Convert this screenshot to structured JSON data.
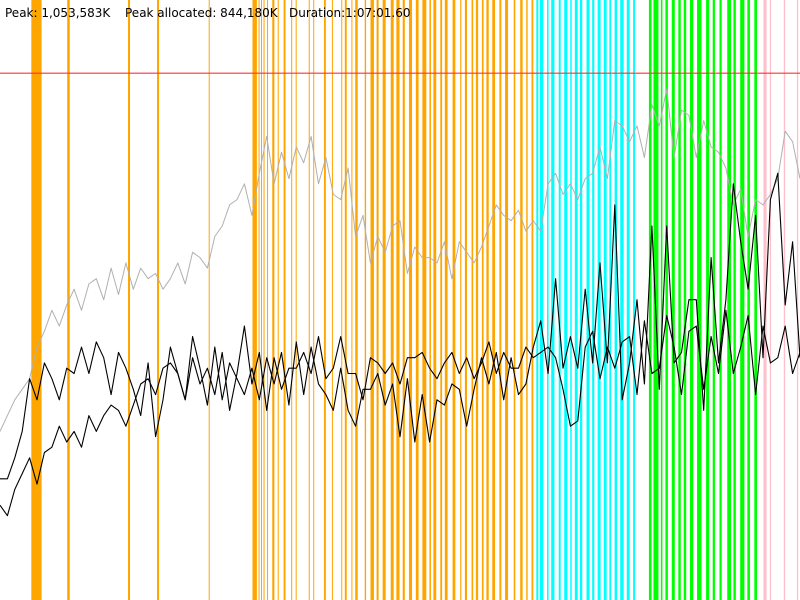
{
  "header": {
    "peak_label": "Peak: 1,053,583K",
    "peak_allocated_label": "Peak allocated: 844,180K",
    "duration_label": "Duration:1:07:01.60"
  },
  "colors": {
    "background": "#ffffff",
    "peak_line": "#ff3333",
    "series_upper": "#000000",
    "series_lower": "#000000",
    "series_gray": "#b0b0b0",
    "phase_orange": "#ffa500",
    "phase_cyan": "#00ffff",
    "phase_green": "#00ff00",
    "phase_pink": "#ffc0cb"
  },
  "chart_data": {
    "type": "line",
    "duration_s": 4021.6,
    "peak_k": 1053583,
    "peak_allocated_k": 844180,
    "y_max_k": 1200000,
    "phases": [
      {
        "color": "orange",
        "ranges": [
          [
            157.6,
            209.1
          ],
          [
            337.8,
            350.7
          ],
          [
            643.5,
            653.6
          ],
          [
            789.4,
            799.5
          ],
          [
            1049.2,
            1054.2
          ],
          [
            1269.3,
            1291.3
          ],
          [
            1299.8,
            1303.2
          ],
          [
            1312.2,
            1316.5
          ],
          [
            1324.8,
            1329.8
          ],
          [
            1342.4,
            1346.8
          ],
          [
            1368.6,
            1379.3
          ],
          [
            1396.0,
            1401.3
          ],
          [
            1425.6,
            1435.5
          ],
          [
            1463.8,
            1467.5
          ],
          [
            1486.3,
            1490.8
          ],
          [
            1552.0,
            1556.3
          ],
          [
            1574.5,
            1578.2
          ],
          [
            1628.5,
            1638.0
          ],
          [
            1668.5,
            1673.3
          ],
          [
            1715.5,
            1719.2
          ],
          [
            1733.3,
            1743.0
          ],
          [
            1766.5,
            1770.5
          ],
          [
            1785.8,
            1798.2
          ],
          [
            1833.5,
            1840.3
          ],
          [
            1862.5,
            1879.8
          ],
          [
            1893.0,
            1903.3
          ],
          [
            1923.5,
            1938.8
          ],
          [
            1964.3,
            1979.0
          ],
          [
            1992.5,
            2008.5
          ],
          [
            2024.3,
            2035.0
          ],
          [
            2055.8,
            2071.3
          ],
          [
            2090.5,
            2104.2
          ],
          [
            2123.3,
            2143.0
          ],
          [
            2158.8,
            2166.5
          ],
          [
            2178.6,
            2193.1
          ],
          [
            2213.4,
            2222.5
          ],
          [
            2236.0,
            2250.0
          ],
          [
            2275.0,
            2289.0
          ],
          [
            2313.4,
            2319.4
          ],
          [
            2337.0,
            2347.5
          ],
          [
            2370.5,
            2378.7
          ],
          [
            2392.3,
            2403.6
          ],
          [
            2422.5,
            2431.0
          ],
          [
            2445.1,
            2456.8
          ],
          [
            2474.6,
            2488.5
          ],
          [
            2510.5,
            2520.5
          ],
          [
            2538.9,
            2554.0
          ],
          [
            2582.4,
            2590.5
          ],
          [
            2615.0,
            2627.3
          ],
          [
            2645.3,
            2652.5
          ],
          [
            2672.0,
            2681.0
          ]
        ]
      },
      {
        "color": "cyan",
        "ranges": [
          [
            2696.1,
            2706.1
          ],
          [
            2713.9,
            2731.0
          ],
          [
            2749.9,
            2757.7
          ],
          [
            2771.0,
            2787.0
          ],
          [
            2808.6,
            2818.6
          ],
          [
            2836.3,
            2852.0
          ],
          [
            2866.5,
            2874.0
          ],
          [
            2889.5,
            2904.0
          ],
          [
            2915.0,
            2927.0
          ],
          [
            2948.4,
            2963.4
          ],
          [
            2976.8,
            2987.5
          ],
          [
            3004.3,
            3019.3
          ],
          [
            3035.0,
            3049.6
          ],
          [
            3063.2,
            3071.9
          ],
          [
            3089.5,
            3101.8
          ],
          [
            3117.9,
            3135.0
          ],
          [
            3150.6,
            3165.4
          ],
          [
            3182.5,
            3192.0
          ]
        ]
      },
      {
        "color": "green",
        "ranges": [
          [
            3262.1,
            3275.3
          ],
          [
            3285.0,
            3310.0
          ],
          [
            3322.2,
            3330.0
          ],
          [
            3345.0,
            3357.6
          ],
          [
            3377.0,
            3392.0
          ],
          [
            3410.0,
            3422.3
          ],
          [
            3437.0,
            3449.5
          ],
          [
            3468.5,
            3484.9
          ],
          [
            3504.1,
            3526.3
          ],
          [
            3549.6,
            3565.0
          ],
          [
            3582.8,
            3594.0
          ],
          [
            3617.0,
            3628.0
          ],
          [
            3656.0,
            3675.0
          ],
          [
            3687.0,
            3699.0
          ],
          [
            3721.0,
            3742.0
          ],
          [
            3757.0,
            3770.0
          ],
          [
            3792.0,
            3805.5
          ]
        ]
      },
      {
        "color": "pink",
        "ranges": [
          [
            3838.0,
            3853.5
          ],
          [
            3869.7,
            3876.0
          ],
          [
            3940.0,
            3947.0
          ],
          [
            4006.0,
            4012.5
          ]
        ]
      }
    ],
    "series": [
      {
        "color": "gray",
        "samples": [
          0.32,
          0.35,
          0.38,
          0.4,
          0.42,
          0.48,
          0.51,
          0.55,
          0.52,
          0.56,
          0.59,
          0.55,
          0.6,
          0.61,
          0.57,
          0.63,
          0.58,
          0.64,
          0.59,
          0.63,
          0.61,
          0.62,
          0.59,
          0.61,
          0.64,
          0.6,
          0.66,
          0.65,
          0.63,
          0.69,
          0.71,
          0.75,
          0.76,
          0.79,
          0.73,
          0.81,
          0.88,
          0.79,
          0.85,
          0.8,
          0.86,
          0.83,
          0.88,
          0.79,
          0.84,
          0.77,
          0.76,
          0.82,
          0.69,
          0.73,
          0.64,
          0.69,
          0.66,
          0.71,
          0.72,
          0.62,
          0.67,
          0.65,
          0.65,
          0.64,
          0.68,
          0.61,
          0.68,
          0.66,
          0.64,
          0.67,
          0.71,
          0.75,
          0.73,
          0.72,
          0.74,
          0.7,
          0.72,
          0.7,
          0.79,
          0.81,
          0.77,
          0.79,
          0.76,
          0.8,
          0.81,
          0.86,
          0.8,
          0.91,
          0.9,
          0.87,
          0.9,
          0.84,
          0.94,
          0.9,
          0.97,
          0.84,
          0.93,
          0.92,
          0.84,
          0.91,
          0.86,
          0.85,
          0.82,
          0.75,
          0.78,
          0.69,
          0.76,
          0.75,
          0.77,
          0.8,
          0.89,
          0.87,
          0.8
        ]
      },
      {
        "color": "upper",
        "samples": [
          0.23,
          0.23,
          0.27,
          0.32,
          0.42,
          0.38,
          0.45,
          0.42,
          0.38,
          0.44,
          0.43,
          0.48,
          0.43,
          0.49,
          0.46,
          0.39,
          0.47,
          0.44,
          0.4,
          0.35,
          0.45,
          0.31,
          0.38,
          0.48,
          0.43,
          0.38,
          0.5,
          0.44,
          0.37,
          0.48,
          0.38,
          0.45,
          0.42,
          0.39,
          0.44,
          0.38,
          0.46,
          0.41,
          0.47,
          0.37,
          0.49,
          0.39,
          0.48,
          0.41,
          0.39,
          0.36,
          0.44,
          0.36,
          0.33,
          0.4,
          0.4,
          0.43,
          0.37,
          0.41,
          0.31,
          0.42,
          0.3,
          0.39,
          0.3,
          0.38,
          0.37,
          0.41,
          0.4,
          0.33,
          0.4,
          0.46,
          0.41,
          0.47,
          0.38,
          0.46,
          0.39,
          0.41,
          0.48,
          0.53,
          0.43,
          0.61,
          0.44,
          0.5,
          0.44,
          0.59,
          0.45,
          0.64,
          0.45,
          0.75,
          0.38,
          0.45,
          0.57,
          0.41,
          0.71,
          0.4,
          0.71,
          0.45,
          0.47,
          0.57,
          0.57,
          0.36,
          0.65,
          0.45,
          0.57,
          0.79,
          0.68,
          0.59,
          0.73,
          0.46,
          0.76,
          0.81,
          0.56,
          0.68,
          0.46
        ]
      },
      {
        "color": "lower",
        "samples": [
          0.18,
          0.16,
          0.21,
          0.24,
          0.27,
          0.22,
          0.28,
          0.29,
          0.33,
          0.3,
          0.32,
          0.29,
          0.35,
          0.32,
          0.35,
          0.37,
          0.36,
          0.33,
          0.37,
          0.41,
          0.42,
          0.39,
          0.44,
          0.45,
          0.43,
          0.38,
          0.46,
          0.41,
          0.44,
          0.39,
          0.47,
          0.36,
          0.43,
          0.52,
          0.41,
          0.47,
          0.36,
          0.46,
          0.4,
          0.44,
          0.44,
          0.47,
          0.43,
          0.5,
          0.42,
          0.44,
          0.5,
          0.43,
          0.43,
          0.38,
          0.46,
          0.45,
          0.43,
          0.45,
          0.41,
          0.46,
          0.46,
          0.47,
          0.44,
          0.42,
          0.45,
          0.47,
          0.43,
          0.46,
          0.42,
          0.45,
          0.49,
          0.43,
          0.47,
          0.44,
          0.44,
          0.48,
          0.46,
          0.47,
          0.48,
          0.46,
          0.4,
          0.33,
          0.34,
          0.48,
          0.51,
          0.42,
          0.48,
          0.44,
          0.49,
          0.5,
          0.39,
          0.53,
          0.43,
          0.44,
          0.54,
          0.48,
          0.39,
          0.51,
          0.52,
          0.4,
          0.5,
          0.43,
          0.55,
          0.43,
          0.48,
          0.54,
          0.39,
          0.52,
          0.45,
          0.46,
          0.52,
          0.43,
          0.47
        ]
      }
    ]
  }
}
